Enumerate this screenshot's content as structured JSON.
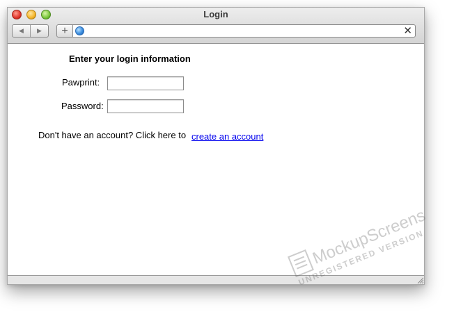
{
  "window": {
    "title": "Login"
  },
  "toolbar": {
    "back_icon": "left-triangle-icon",
    "forward_icon": "right-triangle-icon",
    "add_label": "+",
    "url_value": "",
    "clear_label": "✕"
  },
  "form": {
    "heading": "Enter your login information",
    "pawprint_label": "Pawprint:",
    "pawprint_value": "",
    "password_label": "Password:",
    "password_value": "",
    "signup_text": "Don't have an account? Click here to",
    "signup_link": "create an account"
  },
  "watermark": {
    "brand": "MockupScreens",
    "notice": "UNREGISTERED VERSION"
  },
  "colors": {
    "link": "#0000ee",
    "close": "#e0342a",
    "minimize": "#f5b52a",
    "maximize": "#79c63a"
  }
}
